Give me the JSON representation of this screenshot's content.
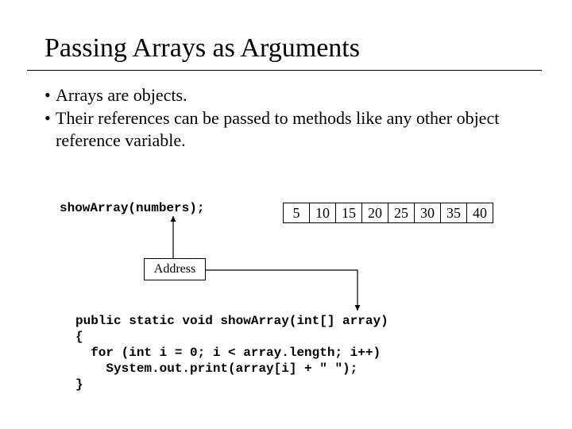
{
  "title": "Passing Arrays as Arguments",
  "bullets": {
    "b1": "Arrays are objects.",
    "b2": "Their references can be passed to methods like any other object reference variable."
  },
  "call_code": "showArray(numbers);",
  "array_cells": {
    "c0": "5",
    "c1": "10",
    "c2": "15",
    "c3": "20",
    "c4": "25",
    "c5": "30",
    "c6": "35",
    "c7": "40"
  },
  "address_label": "Address",
  "method_code": "public static void showArray(int[] array)\n{\n  for (int i = 0; i < array.length; i++)\n    System.out.print(array[i] + \" \");\n}"
}
